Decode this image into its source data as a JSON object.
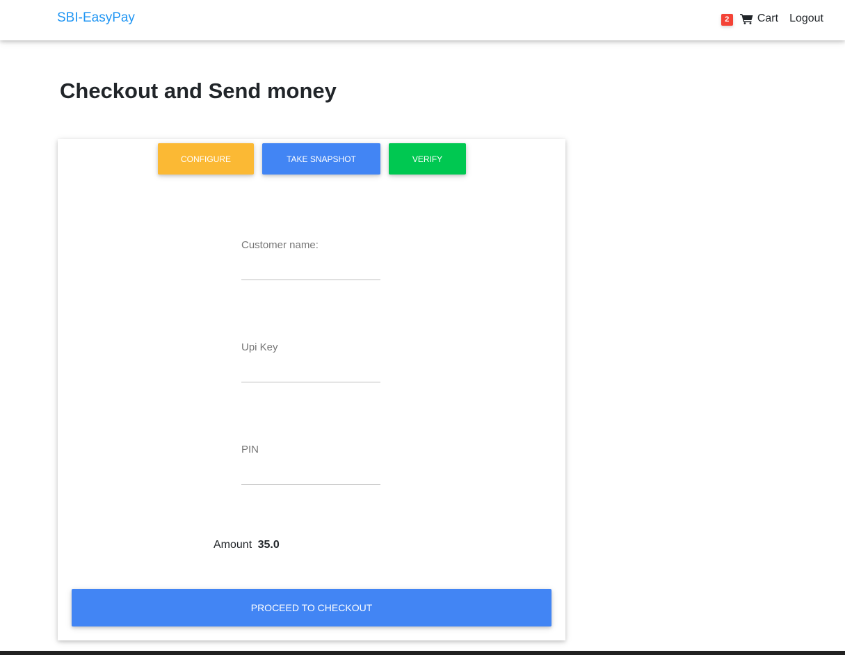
{
  "navbar": {
    "brand": "SBI-EasyPay",
    "cart_count": "2",
    "cart_label": "Cart",
    "logout_label": "Logout"
  },
  "page": {
    "title": "Checkout and Send money"
  },
  "toolbar": {
    "configure_label": "CONFIGURE",
    "snapshot_label": "TAKE SNAPSHOT",
    "verify_label": "VERIFY"
  },
  "form": {
    "customer_name_label": "Customer name:",
    "customer_name_value": "",
    "upi_key_label": "Upi Key",
    "upi_key_value": "",
    "pin_label": "PIN",
    "pin_value": ""
  },
  "amount": {
    "label": "Amount",
    "value": "35.0"
  },
  "checkout": {
    "label": "PROCEED TO CHECKOUT"
  },
  "icons": {
    "cart": "shopping-cart-icon"
  },
  "colors": {
    "brand": "#2196f3",
    "configure": "#fbb934",
    "snapshot": "#4285f4",
    "verify": "#00c851",
    "badge": "#f44336",
    "checkout": "#4285f4"
  }
}
